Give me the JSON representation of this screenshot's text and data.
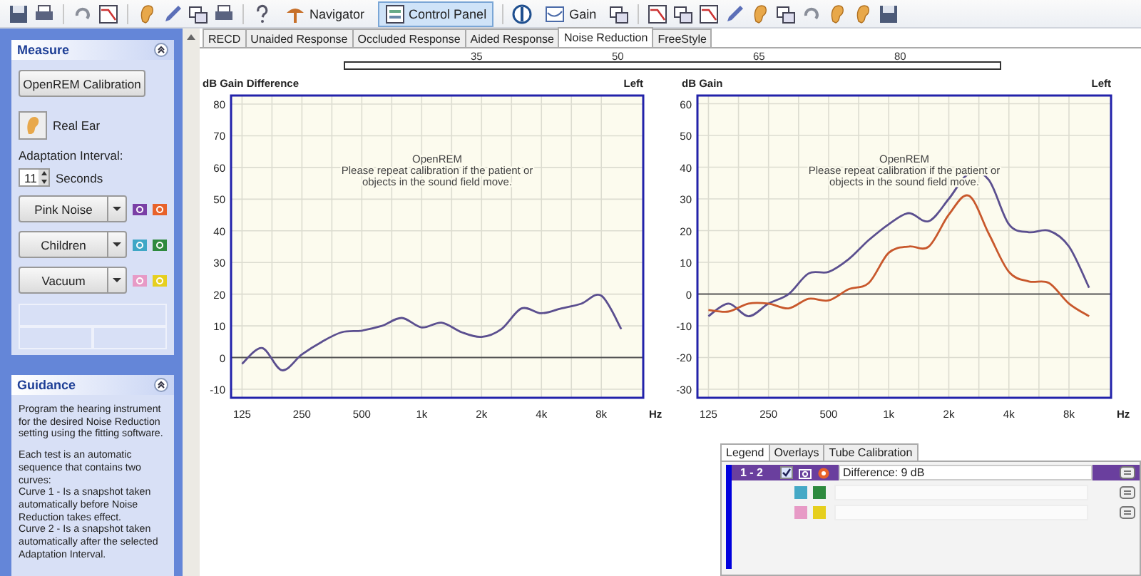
{
  "toolbar": [
    {
      "label": "Navigator",
      "selected": false
    },
    {
      "label": "Control Panel",
      "selected": true
    },
    {
      "label": "Gain",
      "selected": false
    }
  ],
  "sidebar": {
    "measure": {
      "title": "Measure",
      "calibration_button": "OpenREM Calibration",
      "real_ear_button": "Real Ear",
      "adaptation_label": "Adaptation Interval:",
      "adaptation_value": "11",
      "adaptation_unit": "Seconds",
      "noises": [
        {
          "label": "Pink Noise",
          "cameras": [
            {
              "color": "#7a3fa6"
            },
            {
              "color": "#e8622a"
            }
          ]
        },
        {
          "label": "Children",
          "cameras": [
            {
              "color": "#3fa7c6"
            },
            {
              "color": "#2e8a3e"
            }
          ]
        },
        {
          "label": "Vacuum",
          "cameras": [
            {
              "color": "#e79ac6"
            },
            {
              "color": "#e6cf1e"
            }
          ]
        }
      ]
    },
    "guidance": {
      "title": "Guidance",
      "paragraphs": [
        "Program the hearing instrument for the desired Noise Reduction setting using the fitting software.",
        "Each test is an automatic sequence that contains two curves:\nCurve 1 - Is a snapshot taken automatically before Noise Reduction takes effect.\nCurve 2 - Is a snapshot taken automatically after the selected Adaptation Interval."
      ]
    }
  },
  "tabs": [
    {
      "label": "RECD",
      "selected": false
    },
    {
      "label": "Unaided Response",
      "selected": false
    },
    {
      "label": "Occluded Response",
      "selected": false
    },
    {
      "label": "Aided Response",
      "selected": false
    },
    {
      "label": "Noise Reduction",
      "selected": true
    },
    {
      "label": "FreeStyle",
      "selected": false
    }
  ],
  "ruler": {
    "labels": [
      "35",
      "50",
      "65",
      "80"
    ]
  },
  "charts": [
    {
      "side_label": "Left",
      "chart_data": {
        "type": "line",
        "title": "dB Gain Difference",
        "xlabel": "Hz",
        "categories": [
          "125",
          null,
          null,
          "250",
          null,
          null,
          "500",
          null,
          null,
          "1k",
          null,
          null,
          "2k",
          null,
          null,
          "4k",
          null,
          null,
          "8k",
          null
        ],
        "series": [
          {
            "color": "#5b4f8f",
            "values": [
              -2,
              3,
              -4,
              1,
              5,
              8,
              8.5,
              10,
              12.5,
              9.5,
              11,
              8,
              6.5,
              9,
              15.5,
              14,
              15.5,
              17,
              19.5,
              9
            ]
          }
        ],
        "ylim": [
          -12.7,
          82.7
        ],
        "grid": true,
        "yticks": [
          -10,
          0,
          10,
          20,
          30,
          40,
          50,
          60,
          70,
          80
        ],
        "annotations": [
          "OpenREM",
          "Please repeat calibration if the patient or",
          "objects in the sound field move."
        ]
      }
    },
    {
      "side_label": "Left",
      "chart_data": {
        "type": "line",
        "title": "dB Gain",
        "xlabel": "Hz",
        "categories": [
          "125",
          null,
          null,
          "250",
          null,
          null,
          "500",
          null,
          null,
          "1k",
          null,
          null,
          "2k",
          null,
          null,
          "4k",
          null,
          null,
          "8k",
          null
        ],
        "series": [
          {
            "color": "#5b4f8f",
            "values": [
              -7,
              -3,
              -7,
              -3,
              0,
              6.5,
              7,
              11,
              17,
              22,
              25.5,
              23,
              30,
              38,
              36,
              22,
              19.5,
              20,
              15,
              2
            ]
          },
          {
            "color": "#c8582c",
            "values": [
              -5,
              -5.5,
              -3,
              -3,
              -4.5,
              -1.5,
              -2,
              1.5,
              3.5,
              13,
              15,
              15,
              25,
              31,
              19,
              7,
              4,
              3.5,
              -3,
              -7
            ]
          }
        ],
        "ylim": [
          -32.7,
          62.6
        ],
        "grid": true,
        "yticks": [
          -30,
          -20,
          -10,
          0,
          10,
          20,
          30,
          40,
          50,
          60
        ],
        "annotations": [
          "OpenREM",
          "Please repeat calibration if the patient or",
          "objects in the sound field move."
        ]
      }
    }
  ],
  "legend": {
    "tabs": [
      {
        "label": "Legend",
        "selected": true
      },
      {
        "label": "Overlays",
        "selected": false
      },
      {
        "label": "Tube Calibration",
        "selected": false
      }
    ],
    "rows": [
      {
        "kind": "pair",
        "label": "1 - 2",
        "checked": true,
        "value": "Difference: 9 dB",
        "selected": true
      },
      {
        "kind": "swatches",
        "swatches": [
          {
            "color": "#45a9c6"
          },
          {
            "color": "#2e8a3e"
          }
        ],
        "selected": false
      },
      {
        "kind": "swatches",
        "swatches": [
          {
            "color": "#e79ac6"
          },
          {
            "color": "#e6cf1e"
          }
        ],
        "selected": false
      }
    ]
  }
}
